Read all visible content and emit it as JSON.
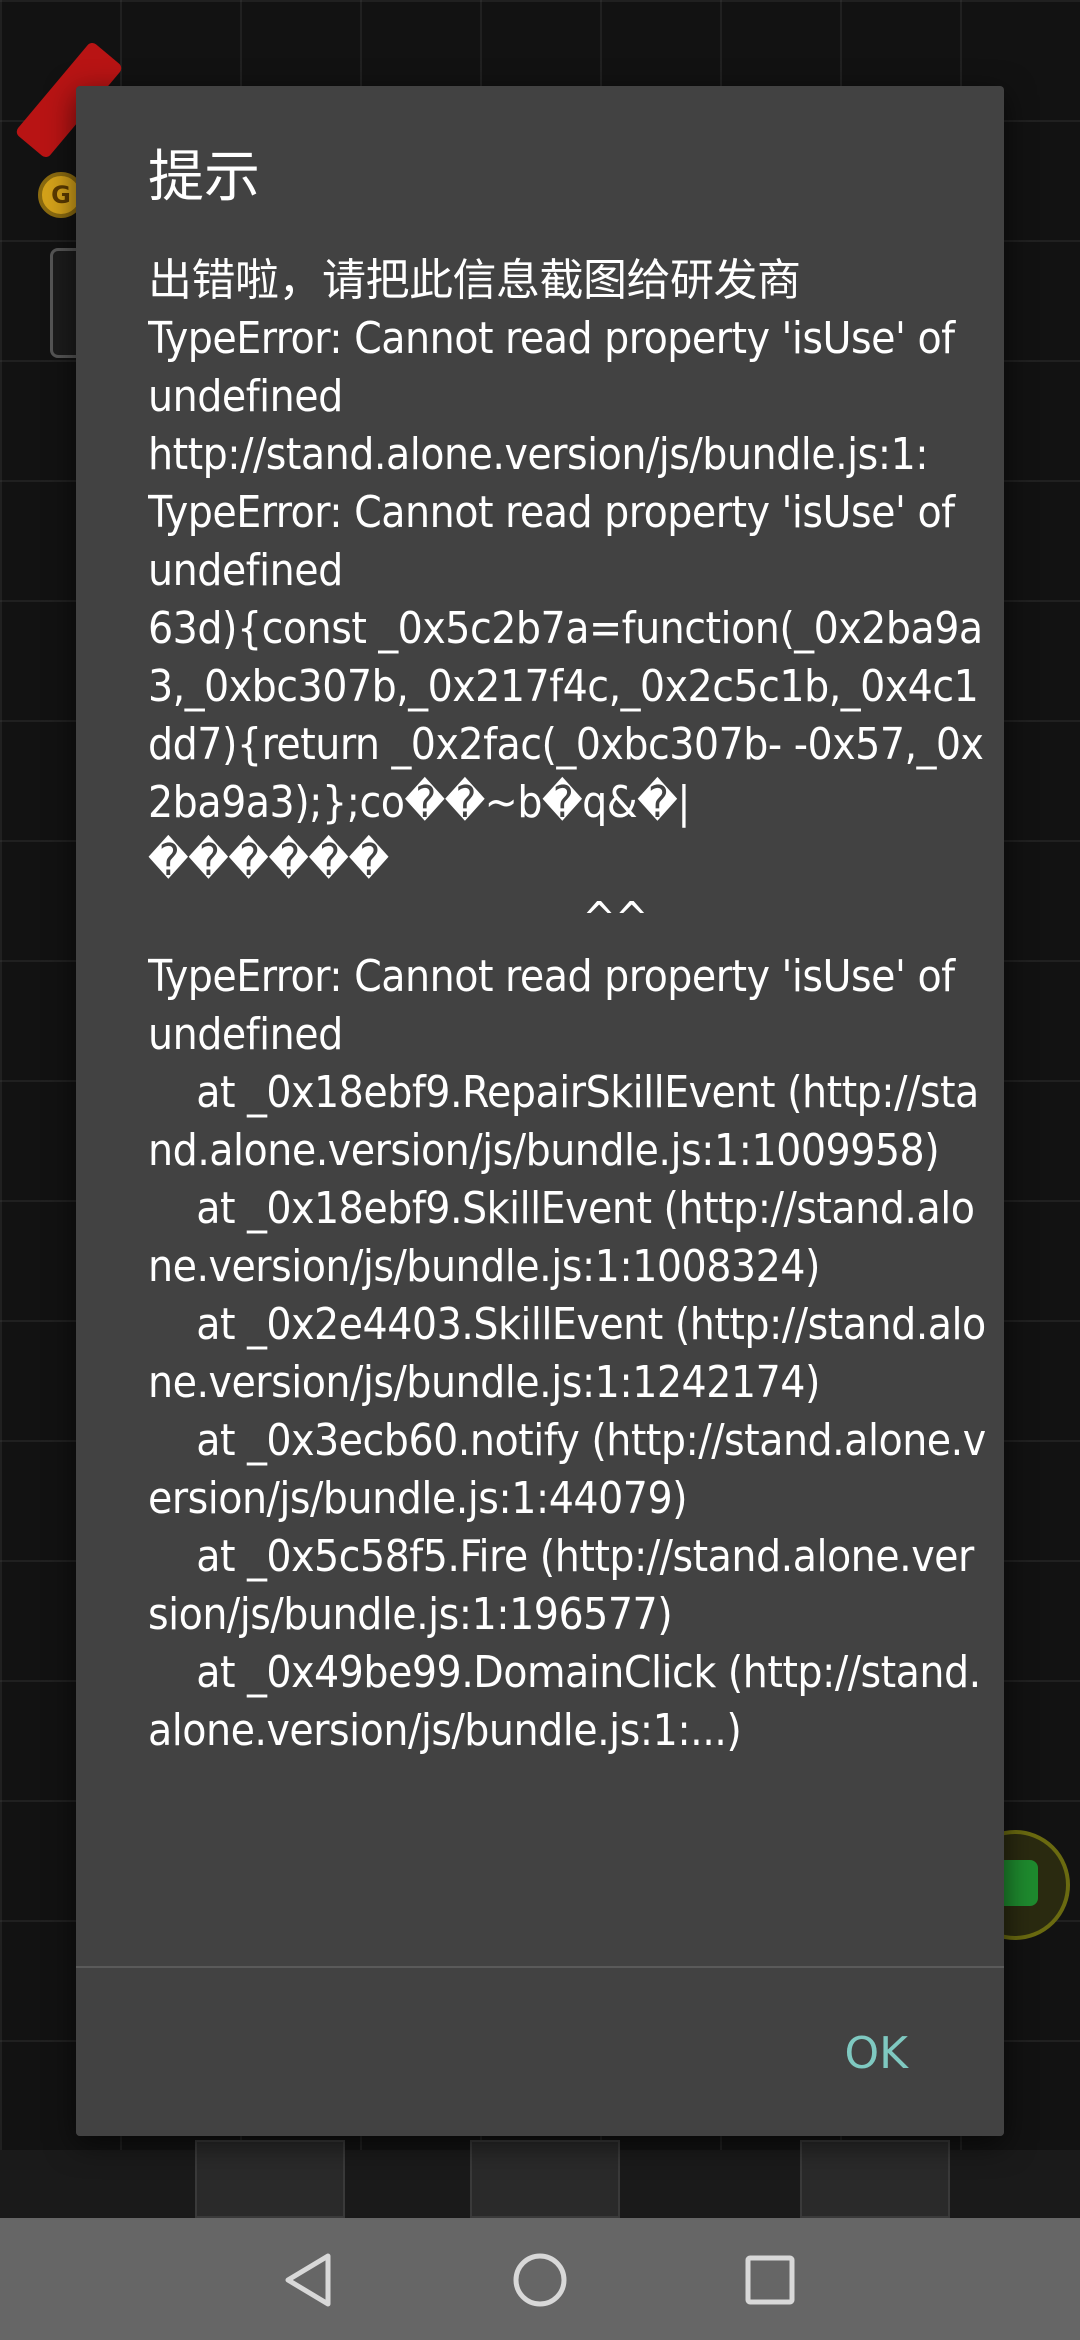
{
  "dialog": {
    "title": "提示",
    "message": "出错啦，请把此信息截图给研发商\nTypeError: Cannot read property 'isUse' of undefined\nhttp://stand.alone.version/js/bundle.js:1:\nTypeError: Cannot read property 'isUse' of undefined\n63d){const _0x5c2b7a=function(_0x2ba9a3,_0xbc307b,_0x217f4c,_0x2c5c1b,_0x4c1dd7){return _0x2fac(_0xbc307b- -0x57,_0x2ba9a3);};co��~b�q&�|\n������\n                                    ^^\nTypeError: Cannot read property 'isUse' of undefined\n    at _0x18ebf9.RepairSkillEvent (http://stand.alone.version/js/bundle.js:1:1009958)\n    at _0x18ebf9.SkillEvent (http://stand.alone.version/js/bundle.js:1:1008324)\n    at _0x2e4403.SkillEvent (http://stand.alone.version/js/bundle.js:1:1242174)\n    at _0x3ecb60.notify (http://stand.alone.version/js/bundle.js:1:44079)\n    at _0x5c58f5.Fire (http://stand.alone.version/js/bundle.js:1:196577)\n    at _0x49be99.DomainClick (http://stand.alone.version/js/bundle.js:1:...)",
    "ok_label": "OK"
  },
  "colors": {
    "dialog_bg": "#424242",
    "accent": "#7fc9c1",
    "nav_bar": "#666666"
  },
  "navigation": {
    "back_icon": "back-triangle-icon",
    "home_icon": "home-circle-icon",
    "recents_icon": "recents-square-icon"
  }
}
